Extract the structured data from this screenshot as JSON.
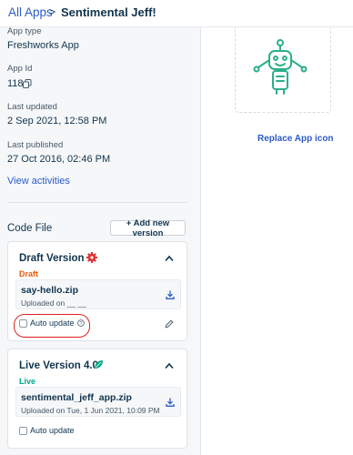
{
  "breadcrumb": {
    "root": "All Apps",
    "separator": ">",
    "current": "Sentimental Jeff!"
  },
  "details": {
    "app_type_label": "App type",
    "app_type_value": "Freshworks App",
    "app_id_label": "App Id",
    "app_id_value": "118",
    "last_updated_label": "Last updated",
    "last_updated_value": "2 Sep 2021, 12:58 PM",
    "last_published_label": "Last published",
    "last_published_value": "27 Oct 2016, 02:46 PM",
    "view_activities": "View activities"
  },
  "code_file": {
    "title": "Code File",
    "add_button": "+ Add new version",
    "versions": [
      {
        "title": "Draft Version",
        "status": "Draft",
        "status_color": "#e8590c",
        "file": "say-hello.zip",
        "uploaded": "Uploaded on __ __",
        "auto_update": "Auto update"
      },
      {
        "title": "Live Version 4.0",
        "status": "Live",
        "status_color": "#00a886",
        "file": "sentimental_jeff_app.zip",
        "uploaded": "Uploaded on Tue, 1 Jun 2021, 10:09 PM",
        "auto_update": "Auto update"
      }
    ]
  },
  "icon_panel": {
    "replace": "Replace App icon",
    "robot_color": "#2bb08a"
  },
  "icons": [
    "copy-icon",
    "gear-icon",
    "chevron-up-icon",
    "download-icon",
    "help-icon",
    "edit-icon",
    "leaf-icon",
    "robot-icon"
  ]
}
